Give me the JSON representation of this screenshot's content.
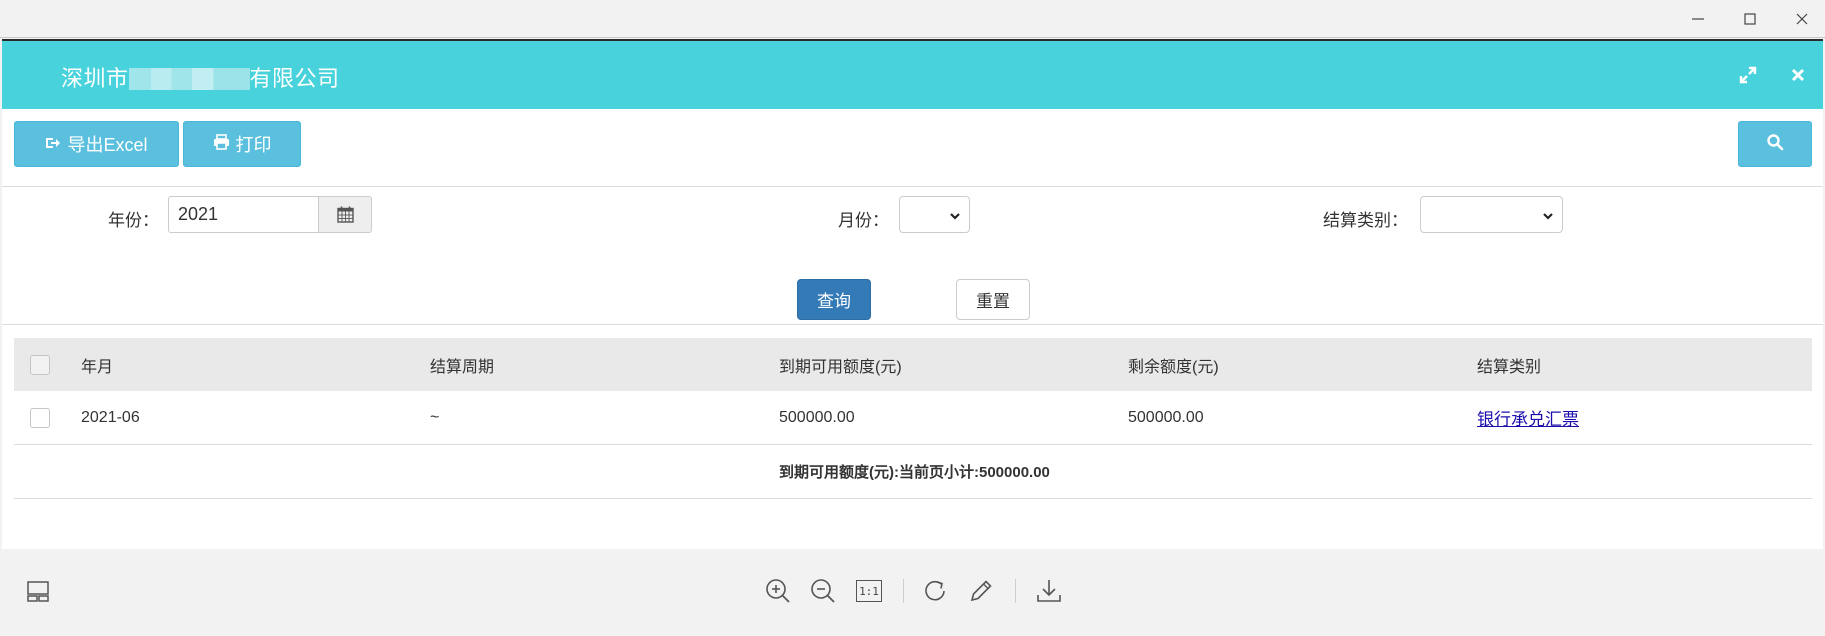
{
  "window": {
    "controls": {
      "minimize": "minimize-icon",
      "maximize": "maximize-icon",
      "close": "close-icon"
    }
  },
  "modal": {
    "title_prefix": "深圳市",
    "title_suffix": "有限公司",
    "header_color": "#47d2dc"
  },
  "toolbar": {
    "export_label": "导出Excel",
    "print_label": "打印",
    "button_color": "#5bc0de"
  },
  "filters": {
    "year_label": "年份：",
    "year_value": "2021",
    "month_label": "月份：",
    "month_value": "",
    "type_label": "结算类别：",
    "type_value": "",
    "query_label": "查询",
    "reset_label": "重置",
    "query_color": "#337ab7"
  },
  "table": {
    "columns": [
      "年月",
      "结算周期",
      "到期可用额度(元)",
      "剩余额度(元)",
      "结算类别"
    ],
    "rows": [
      {
        "year_month": "2021-06",
        "period": "~",
        "available": "500000.00",
        "remaining": "500000.00",
        "type": "银行承兑汇票"
      }
    ],
    "subtotal": "到期可用额度(元):当前页小计:500000.00"
  },
  "viewer": {
    "icons": [
      "layout-icon",
      "zoom-in-icon",
      "zoom-out-icon",
      "actual-size-icon",
      "rotate-icon",
      "edit-icon",
      "download-icon"
    ],
    "actual_size_label": "1:1"
  }
}
